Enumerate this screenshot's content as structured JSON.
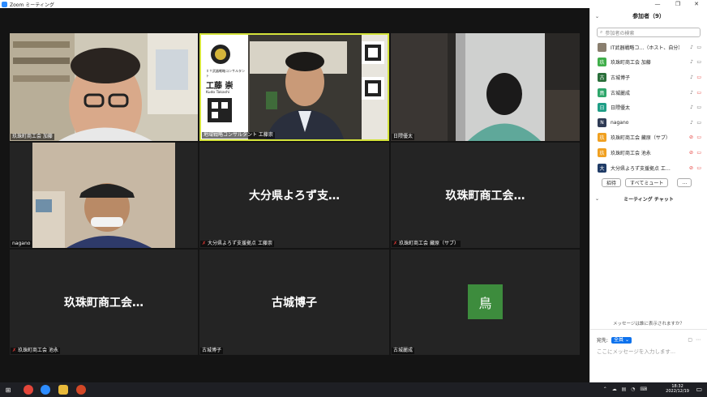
{
  "window": {
    "title": "Zoom ミーティング",
    "controls": [
      "—",
      "❐",
      "✕"
    ]
  },
  "tiles": [
    {
      "name": "玖珠町商工会  加藤",
      "big": "",
      "muted": false,
      "bg": "#6f6a5c"
    },
    {
      "name": "地域戦略コンサルタント 工藤崇",
      "big": "",
      "muted": false,
      "bg": "#3b3a36"
    },
    {
      "name": "日隈優太",
      "big": "",
      "muted": false,
      "bg": "#2c2c2c"
    },
    {
      "name": "nagano",
      "big": "",
      "muted": false,
      "bg": "#a89c8c"
    },
    {
      "name": "大分県よろず支援拠点 工藤崇",
      "big": "大分県よろず支…",
      "muted": true,
      "bg": "#242424"
    },
    {
      "name": "玖珠町商工会  藏原（サブ）",
      "big": "玖珠町商工会…",
      "muted": true,
      "bg": "#242424"
    },
    {
      "name": "玖珠町商工会  池永",
      "big": "玖珠町商工会…",
      "muted": true,
      "bg": "#242424"
    },
    {
      "name": "古城博子",
      "big": "古城博子",
      "muted": false,
      "bg": "#242424"
    },
    {
      "name": "古城麗成",
      "big": "",
      "muted": false,
      "bg": "#242424"
    }
  ],
  "avatar_tile": {
    "letter": "鳥",
    "color": "#3d8c3d"
  },
  "card": {
    "small": "ＩＴ武器戦略コンサルタント",
    "name": "工藤 崇",
    "romaji": "Kudo Takashi"
  },
  "sidebar": {
    "title": "参加者（9）",
    "search_placeholder": "参加者の検索",
    "participants": [
      {
        "initial": "",
        "name": "IT武器戦略コ…（ホスト、自分）",
        "color": "#8a7f6f",
        "mic_off": false,
        "cam_off": false
      },
      {
        "initial": "玖",
        "name": "玖珠町商工会  加藤",
        "color": "#3fae49",
        "mic_off": false,
        "cam_off": false
      },
      {
        "initial": "古",
        "name": "古城博子",
        "color": "#2a6f3a",
        "mic_off": false,
        "cam_off": true
      },
      {
        "initial": "鳥",
        "name": "古城麗成",
        "color": "#2ea66a",
        "mic_off": false,
        "cam_off": true
      },
      {
        "initial": "日",
        "name": "日隈優太",
        "color": "#1f9e86",
        "mic_off": false,
        "cam_off": false
      },
      {
        "initial": "N",
        "name": "nagano",
        "color": "#2f3b55",
        "mic_off": false,
        "cam_off": false
      },
      {
        "initial": "玖",
        "name": "玖珠町商工会  藏原（サブ）",
        "color": "#f0a020",
        "mic_off": true,
        "cam_off": true
      },
      {
        "initial": "玖",
        "name": "玖珠町商工会  池永",
        "color": "#f0a020",
        "mic_off": true,
        "cam_off": true
      },
      {
        "initial": "大",
        "name": "大分県よろず支援拠点 工…",
        "color": "#1f3b66",
        "mic_off": true,
        "cam_off": true
      }
    ],
    "invite_label": "招待",
    "mute_all_label": "すべてミュート",
    "more_label": "…",
    "chat_title": "ミーティング チャット",
    "who_can_see": "メッセージは誰に表示されますか？",
    "to_label": "宛先:",
    "to_value": "全員",
    "input_placeholder": "ここにメッセージを入力します..."
  },
  "taskbar": {
    "time": "18:32",
    "date": "2022/12/19"
  }
}
